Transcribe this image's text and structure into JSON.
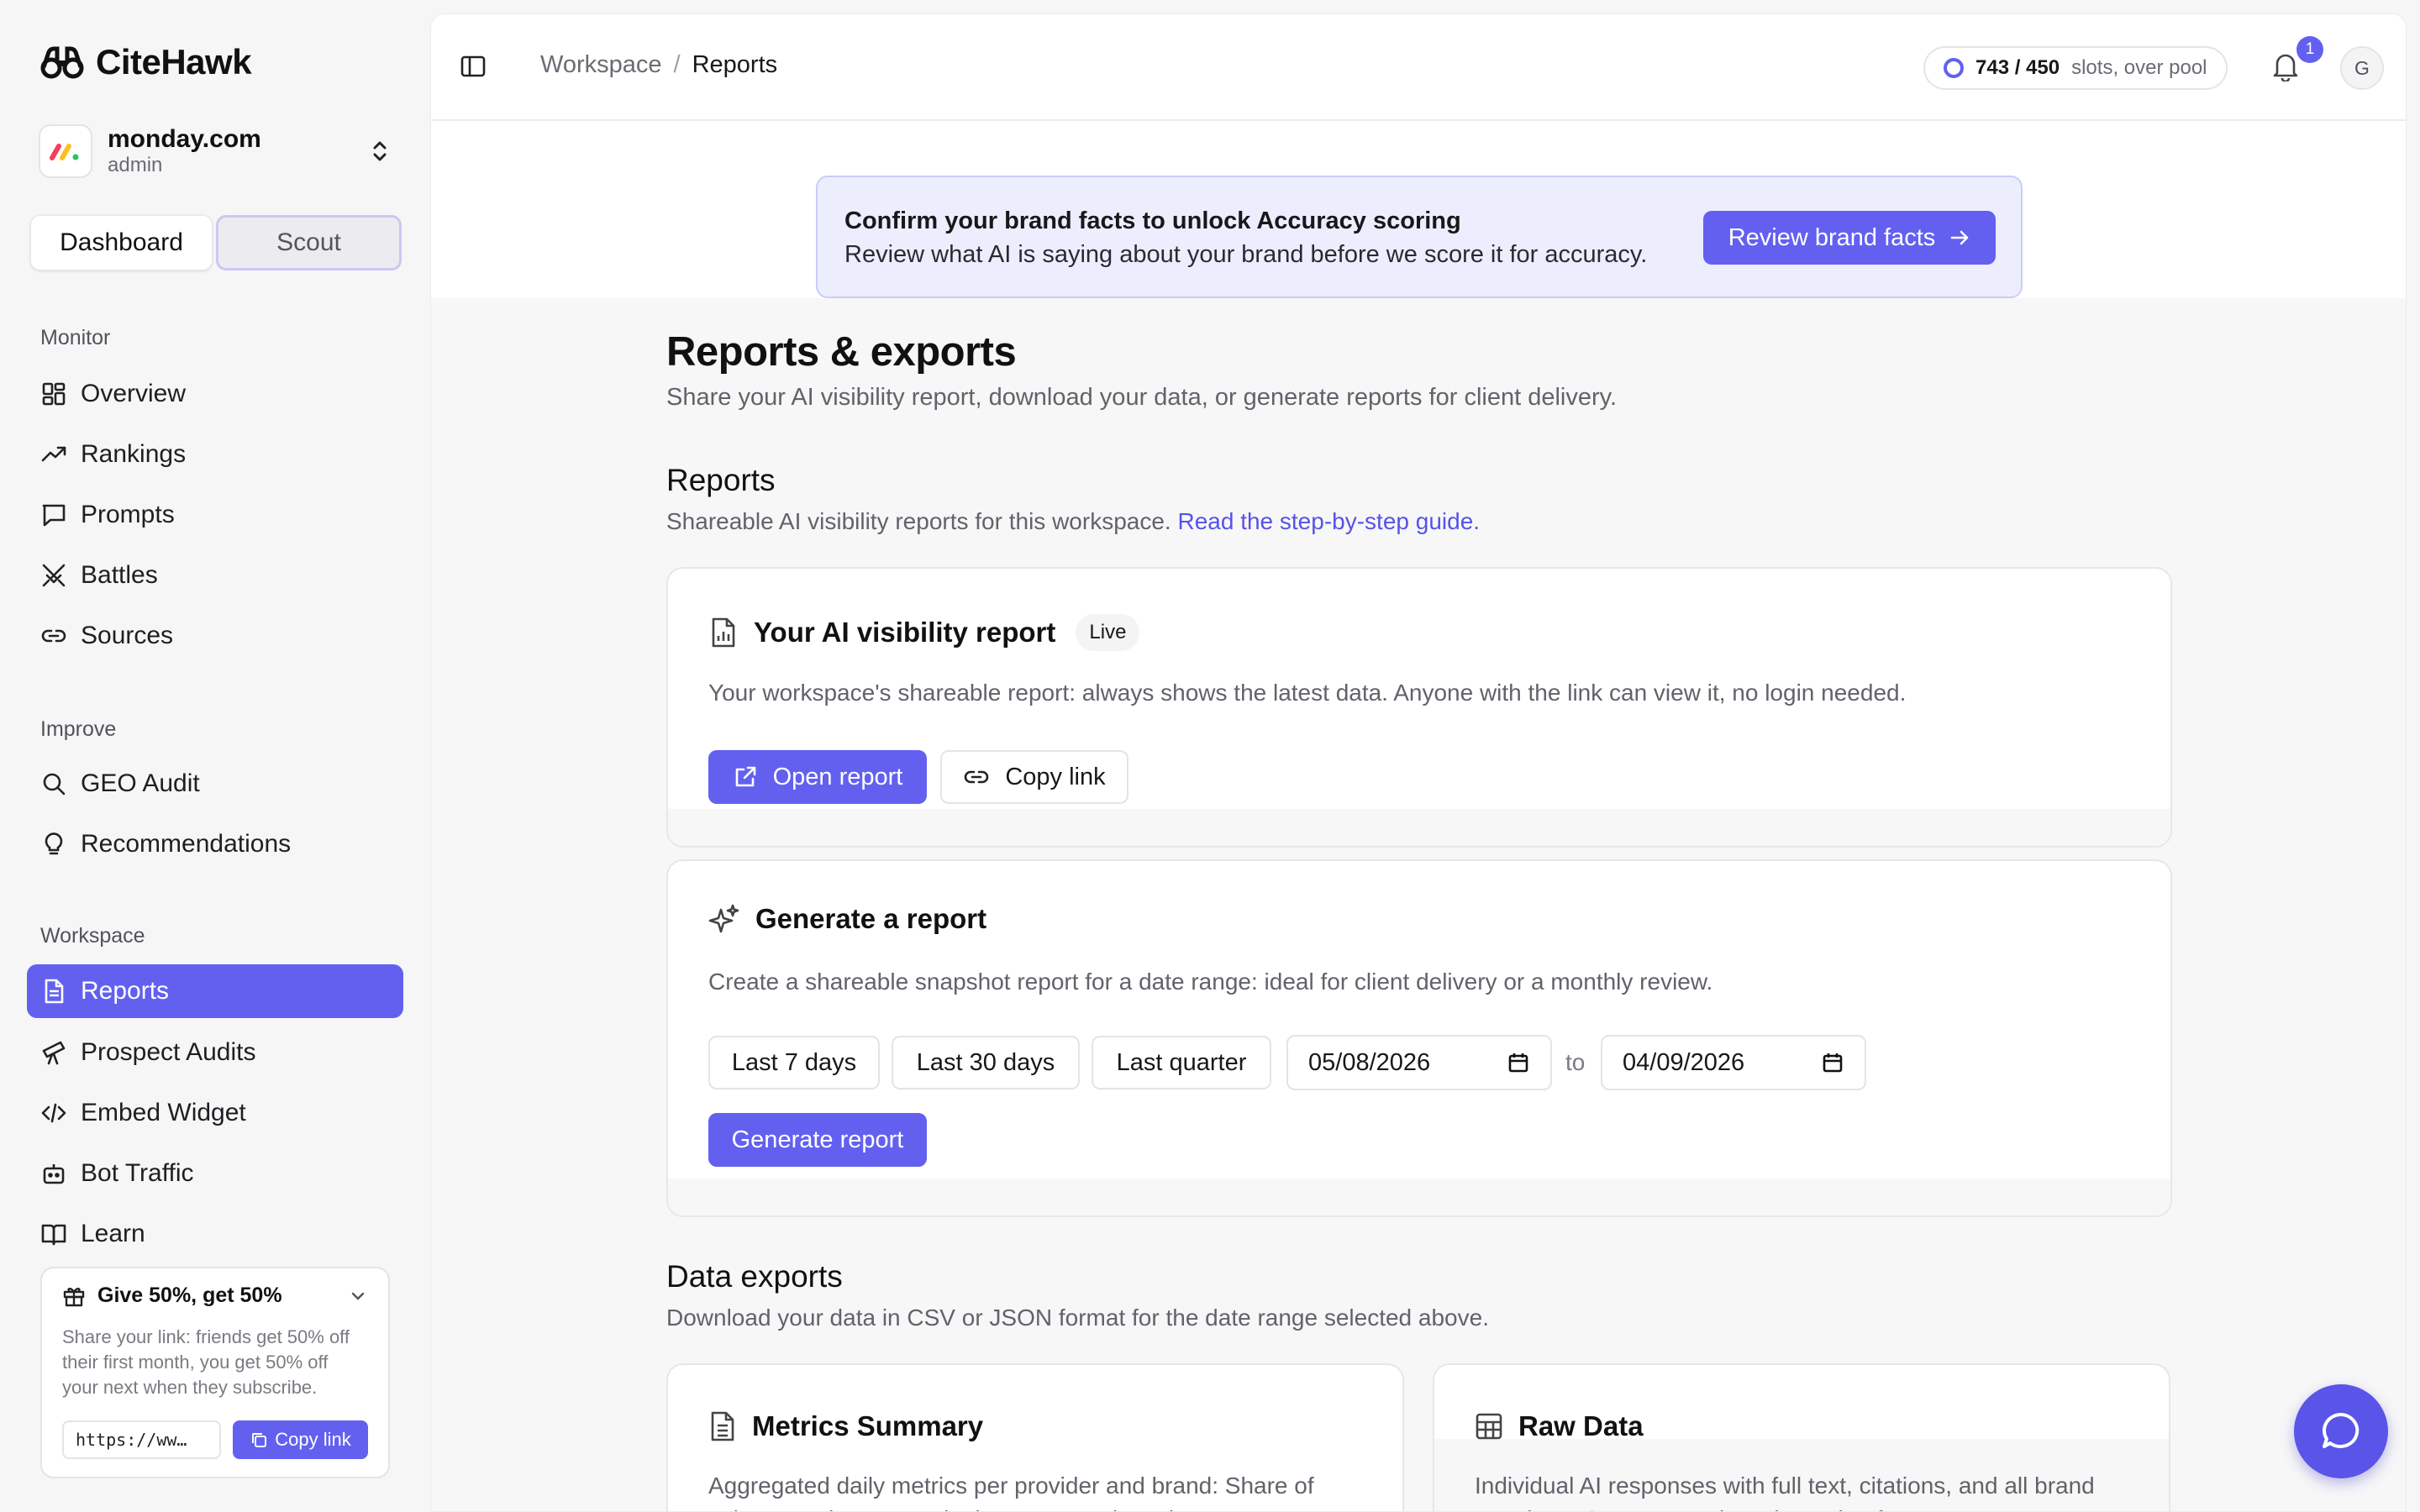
{
  "app": {
    "name": "CiteHawk"
  },
  "org": {
    "name": "monday.com",
    "role": "admin"
  },
  "mode_toggle": {
    "dashboard": "Dashboard",
    "scout": "Scout"
  },
  "sidebar": {
    "monitor_title": "Monitor",
    "monitor_items": [
      {
        "label": "Overview",
        "icon": "grid-icon"
      },
      {
        "label": "Rankings",
        "icon": "trending-up-icon"
      },
      {
        "label": "Prompts",
        "icon": "chat-bubble-icon"
      },
      {
        "label": "Battles",
        "icon": "crossed-swords-icon"
      },
      {
        "label": "Sources",
        "icon": "link-icon"
      }
    ],
    "improve_title": "Improve",
    "improve_items": [
      {
        "label": "GEO Audit",
        "icon": "search-icon"
      },
      {
        "label": "Recommendations",
        "icon": "lightbulb-icon"
      }
    ],
    "workspace_title": "Workspace",
    "workspace_items": [
      {
        "label": "Reports",
        "icon": "document-icon",
        "active": true
      },
      {
        "label": "Prospect Audits",
        "icon": "telescope-icon"
      },
      {
        "label": "Embed Widget",
        "icon": "code-icon"
      },
      {
        "label": "Bot Traffic",
        "icon": "bot-icon"
      },
      {
        "label": "Learn",
        "icon": "book-icon"
      }
    ]
  },
  "referral": {
    "title": "Give 50%, get 50%",
    "text": "Share your link: friends get 50% off their first month, you get 50% off your next when they subscribe.",
    "link_value": "https://ww…",
    "copy_label": "Copy link"
  },
  "topbar": {
    "breadcrumb_parent": "Workspace",
    "breadcrumb_sep": "/",
    "breadcrumb_current": "Reports",
    "slots_count": "743 / 450",
    "slots_label": "slots, over pool",
    "notifications_count": "1",
    "avatar_initial": "G"
  },
  "banner": {
    "title": "Confirm your brand facts to unlock Accuracy scoring",
    "subtitle": "Review what AI is saying about your brand before we score it for accuracy.",
    "button": "Review brand facts"
  },
  "page": {
    "title": "Reports & exports",
    "subtitle": "Share your AI visibility report, download your data, or generate reports for client delivery."
  },
  "reports": {
    "title": "Reports",
    "subtitle": "Shareable AI visibility reports for this workspace.",
    "guide_link": "Read the step-by-step guide."
  },
  "visibility_card": {
    "title": "Your AI visibility report",
    "badge": "Live",
    "description": "Your workspace's shareable report: always shows the latest data. Anyone with the link can view it, no login needed.",
    "open_button": "Open report",
    "copy_button": "Copy link"
  },
  "generate_card": {
    "title": "Generate a report",
    "description": "Create a shareable snapshot report for a date range: ideal for client delivery or a monthly review.",
    "preset_7": "Last 7 days",
    "preset_30": "Last 30 days",
    "preset_quarter": "Last quarter",
    "from_date": "05/08/2026",
    "to_label": "to",
    "to_date": "04/09/2026",
    "generate_button": "Generate report"
  },
  "data_exports": {
    "title": "Data exports",
    "subtitle": "Download your data in CSV or JSON format for the date range selected above.",
    "metrics": {
      "title": "Metrics Summary",
      "description": "Aggregated daily metrics per provider and brand: Share of voice, mention rates, citation rates, and sentiment scores."
    },
    "raw": {
      "title": "Raw Data",
      "description": "Individual AI responses with full text, citations, and all brand mentions. One row per brand mention for easy"
    }
  },
  "colors": {
    "accent": "#6360f0",
    "banner_bg": "#eceefe",
    "link": "#5653e8"
  }
}
